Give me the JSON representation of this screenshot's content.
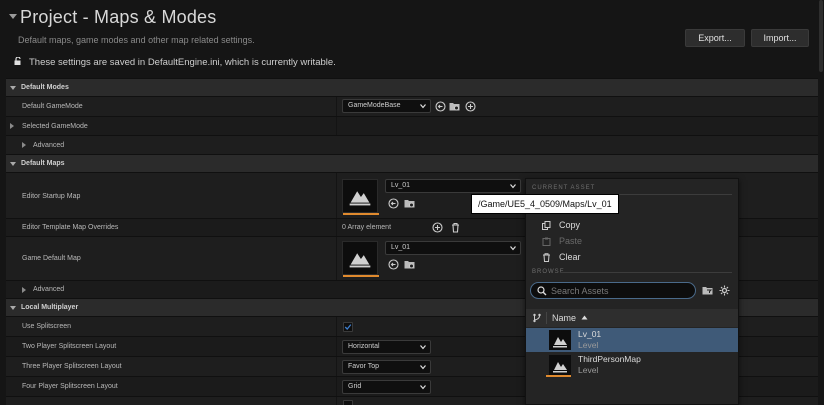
{
  "header": {
    "title": "Project - Maps & Modes",
    "subtitle": "Default maps, game modes and other map related settings.",
    "export_label": "Export...",
    "import_label": "Import...",
    "saved_note": "These settings are saved in DefaultEngine.ini, which is currently writable."
  },
  "sections": {
    "default_modes": {
      "label": "Default Modes",
      "default_gamemode_label": "Default GameMode",
      "default_gamemode_value": "GameModeBase",
      "selected_gamemode_label": "Selected GameMode",
      "advanced_label": "Advanced"
    },
    "default_maps": {
      "label": "Default Maps",
      "editor_startup_map_label": "Editor Startup Map",
      "editor_startup_map_value": "Lv_01",
      "editor_template_overrides_label": "Editor Template Map Overrides",
      "array_count": "0 Array element",
      "game_default_map_label": "Game Default Map",
      "game_default_map_value": "Lv_01",
      "advanced_label": "Advanced"
    },
    "local_multiplayer": {
      "label": "Local Multiplayer",
      "use_splitscreen_label": "Use Splitscreen",
      "use_splitscreen_checked": true,
      "two_player_label": "Two Player Splitscreen Layout",
      "two_player_value": "Horizontal",
      "three_player_label": "Three Player Splitscreen Layout",
      "three_player_value": "Favor Top",
      "four_player_label": "Four Player Splitscreen Layout",
      "four_player_value": "Grid"
    }
  },
  "tooltip": "/Game/UE5_4_0509/Maps/Lv_01",
  "asset_picker": {
    "current_asset_heading": "CURRENT ASSET",
    "menu": {
      "copy_label": "Copy",
      "paste_label": "Paste",
      "clear_label": "Clear"
    },
    "browse_heading": "BROWSE",
    "search_placeholder": "Search Assets",
    "name_column": "Name",
    "assets": [
      {
        "name": "Lv_01",
        "kind": "Level",
        "selected": true
      },
      {
        "name": "ThirdPersonMap",
        "kind": "Level",
        "selected": false
      }
    ]
  },
  "colors": {
    "accent_orange": "#e08a2e",
    "selection_blue": "#3f5a78",
    "checkbox_blue": "#3d7fcf"
  }
}
